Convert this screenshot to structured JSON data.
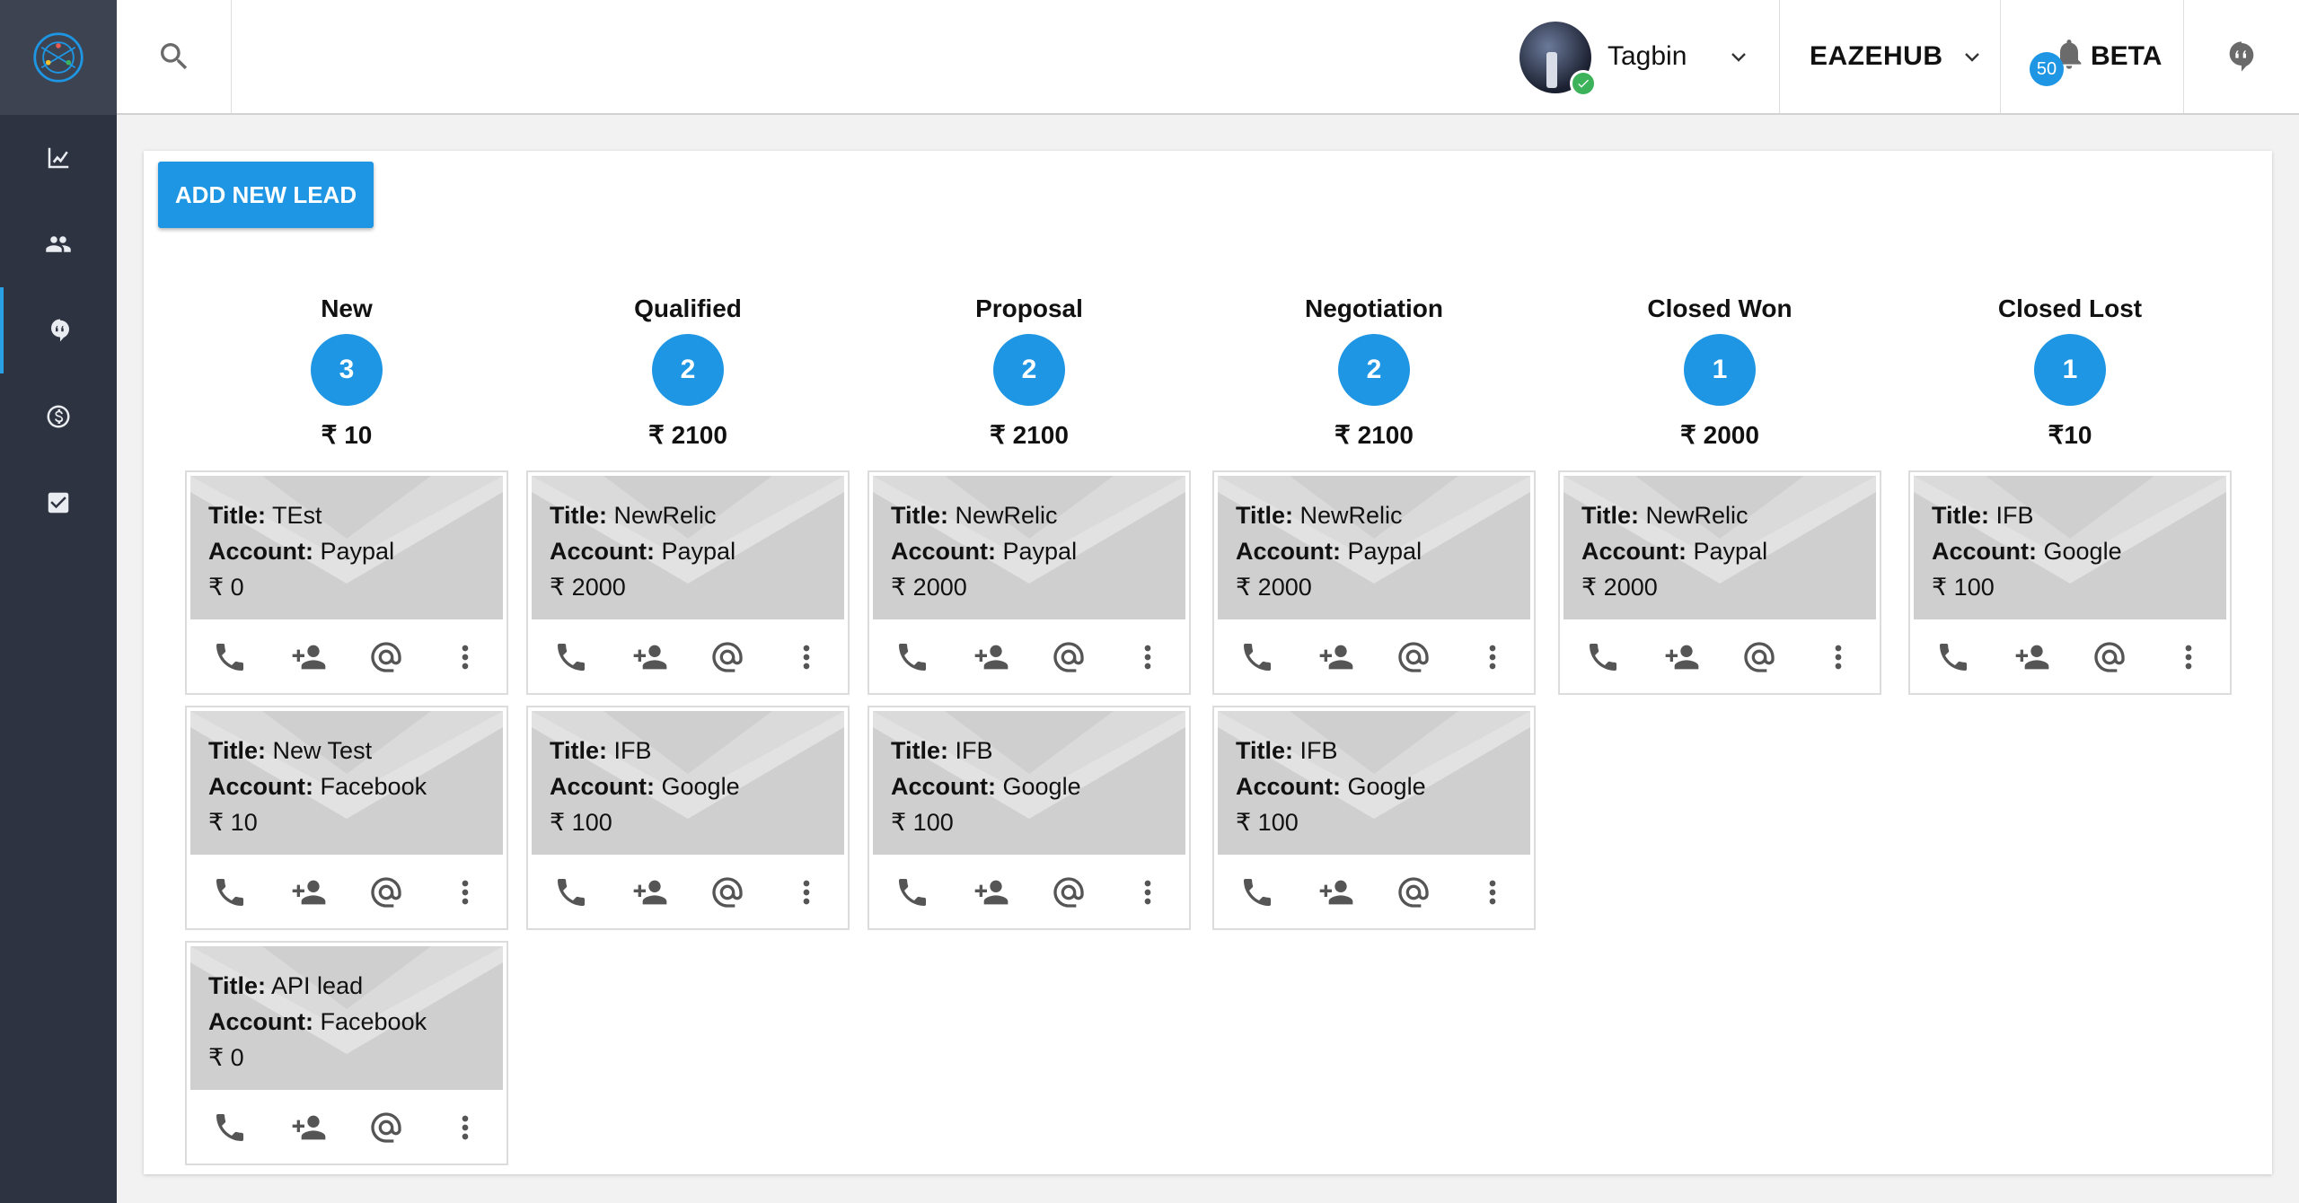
{
  "header": {
    "username": "Tagbin",
    "organization": "EAZEHUB",
    "notification_count": "50",
    "beta_label": "BETA"
  },
  "main": {
    "add_lead_label": "ADD NEW LEAD",
    "columns": [
      {
        "title": "New",
        "count": "3",
        "total": "₹ 10",
        "cards": [
          {
            "title": "TEst",
            "account": "Paypal",
            "amount": "₹ 0"
          },
          {
            "title": "New Test",
            "account": "Facebook",
            "amount": "₹ 10"
          },
          {
            "title": "API lead",
            "account": "Facebook",
            "amount": "₹ 0"
          }
        ]
      },
      {
        "title": "Qualified",
        "count": "2",
        "total": "₹ 2100",
        "cards": [
          {
            "title": "NewRelic",
            "account": "Paypal",
            "amount": "₹ 2000"
          },
          {
            "title": "IFB",
            "account": "Google",
            "amount": "₹ 100"
          }
        ]
      },
      {
        "title": "Proposal",
        "count": "2",
        "total": "₹ 2100",
        "cards": [
          {
            "title": "NewRelic",
            "account": "Paypal",
            "amount": "₹ 2000"
          },
          {
            "title": "IFB",
            "account": "Google",
            "amount": "₹ 100"
          }
        ]
      },
      {
        "title": "Negotiation",
        "count": "2",
        "total": "₹ 2100",
        "cards": [
          {
            "title": "NewRelic",
            "account": "Paypal",
            "amount": "₹ 2000"
          },
          {
            "title": "IFB",
            "account": "Google",
            "amount": "₹ 100"
          }
        ]
      },
      {
        "title": "Closed Won",
        "count": "1",
        "total": "₹ 2000",
        "cards": [
          {
            "title": "NewRelic",
            "account": "Paypal",
            "amount": "₹ 2000"
          }
        ]
      },
      {
        "title": "Closed Lost",
        "count": "1",
        "total": "₹10",
        "cards": [
          {
            "title": "IFB",
            "account": "Google",
            "amount": "₹ 100"
          }
        ]
      }
    ],
    "card_labels": {
      "title": "Title:",
      "account": "Account:"
    }
  },
  "sidebar": {
    "items": [
      {
        "icon": "analytics-icon"
      },
      {
        "icon": "people-icon"
      },
      {
        "icon": "leads-icon"
      },
      {
        "icon": "dollar-icon"
      },
      {
        "icon": "task-check-icon"
      }
    ]
  },
  "colors": {
    "accent": "#1e96e3",
    "sidebar": "#2d3340",
    "online": "#3cb25a"
  }
}
